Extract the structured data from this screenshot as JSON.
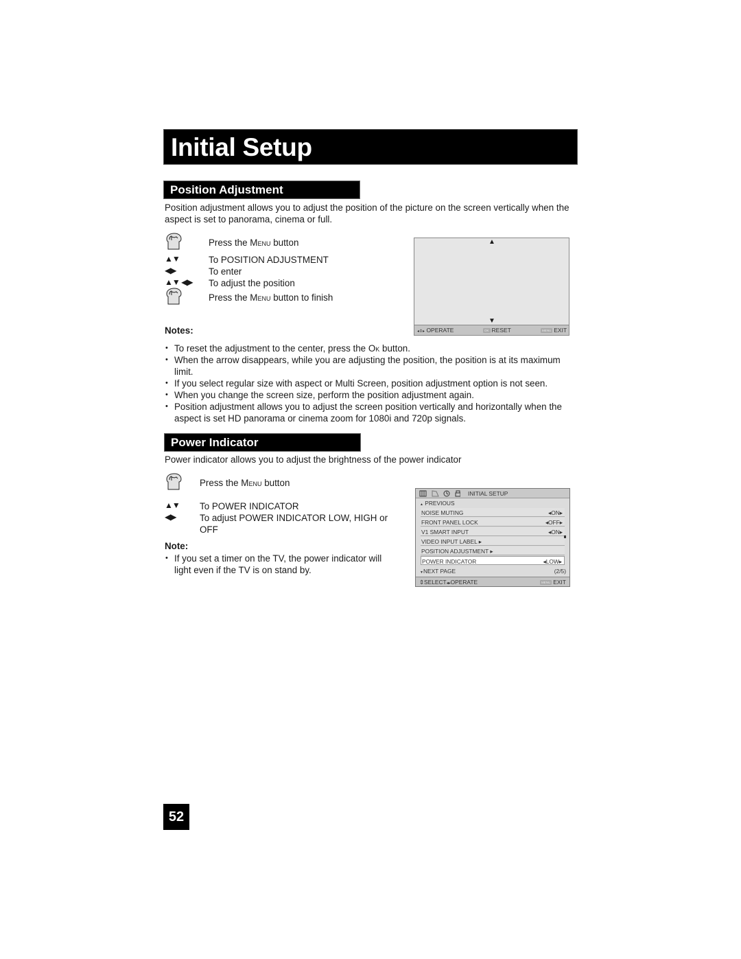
{
  "page_title": "Initial Setup",
  "page_number": "52",
  "position_adjustment": {
    "heading": "Position Adjustment",
    "intro": "Position adjustment allows you to adjust the position of the picture on the screen vertically when the aspect is set to panorama, cinema or full.",
    "steps": [
      {
        "icon": "hand-press-icon",
        "pre": "Press the ",
        "key": "Menu",
        "post": " button"
      },
      {
        "icon": "up-down-arrows-icon",
        "glyph": "▲▼",
        "pre": "To POSITION ADJUSTMENT",
        "key": "",
        "post": ""
      },
      {
        "icon": "left-right-arrows-icon",
        "glyph": "◀▶",
        "pre": "To enter",
        "key": "",
        "post": ""
      },
      {
        "icon": "four-way-arrows-icon",
        "glyph": "▲▼ ◀▶",
        "pre": "To adjust the position",
        "key": "",
        "post": ""
      },
      {
        "icon": "hand-press-icon",
        "pre": "Press the ",
        "key": "Menu",
        "post": " button to finish"
      }
    ],
    "notes_heading": "Notes:",
    "notes": [
      {
        "pre": "To reset the adjustment to the center, press the ",
        "key": "Ok",
        "post": " button."
      },
      {
        "pre": "When the arrow disappears, while you are adjusting the position, the position is at its maximum limit.",
        "key": "",
        "post": ""
      },
      {
        "pre": "If you select regular size with aspect or Multi Screen, position adjustment option is not seen.",
        "key": "",
        "post": ""
      },
      {
        "pre": "When you change the screen size, perform the position adjustment again.",
        "key": "",
        "post": ""
      },
      {
        "pre": "Position adjustment allows you to adjust the screen position vertically and horizontally when the aspect is set HD panorama or cinema zoom for 1080i and 720p signals.",
        "key": "",
        "post": ""
      }
    ],
    "screen": {
      "up_arrow": "▲",
      "down_arrow": "▼",
      "operate_label": "OPERATE",
      "ok_key": "OK",
      "reset_label": "RESET",
      "menu_key": "MENU",
      "exit_label": "EXIT"
    }
  },
  "power_indicator": {
    "heading": "Power Indicator",
    "intro": "Power indicator allows you to adjust the brightness of the power indicator",
    "steps": [
      {
        "icon": "hand-press-icon",
        "pre": "Press the ",
        "key": "Menu",
        "post": " button"
      },
      {
        "icon": "up-down-arrows-icon",
        "glyph": "▲▼",
        "pre": "To POWER INDICATOR"
      },
      {
        "icon": "left-right-arrows-icon",
        "glyph": "◀▶",
        "pre": "To adjust POWER INDICATOR LOW, HIGH or OFF"
      }
    ],
    "note_heading": "Note:",
    "note": "If you set a timer on the TV, the power indicator will light even if the TV is on stand by.",
    "menu": {
      "title": "INITIAL SETUP",
      "tabs": [
        "picture-icon",
        "sound-icon",
        "timer-icon",
        "setup-icon"
      ],
      "previous": "PREVIOUS",
      "rows": [
        {
          "label": "NOISE MUTING",
          "value": "ON",
          "has_value": true
        },
        {
          "label": "FRONT PANEL LOCK",
          "value": "OFF",
          "has_value": true
        },
        {
          "label": "V1 SMART INPUT",
          "value": "ON",
          "has_value": true
        },
        {
          "label": "VIDEO INPUT LABEL",
          "value": "",
          "has_value": false
        },
        {
          "label": "POSITION ADJUSTMENT",
          "value": "",
          "has_value": false
        },
        {
          "label": "POWER INDICATOR",
          "value": "LOW",
          "has_value": true,
          "selected": true
        }
      ],
      "next_page": "NEXT PAGE",
      "page_indicator": "(2/5)",
      "select_label": "SELECT",
      "operate_label": "OPERATE",
      "menu_key": "MENU",
      "exit_label": "EXIT"
    }
  }
}
